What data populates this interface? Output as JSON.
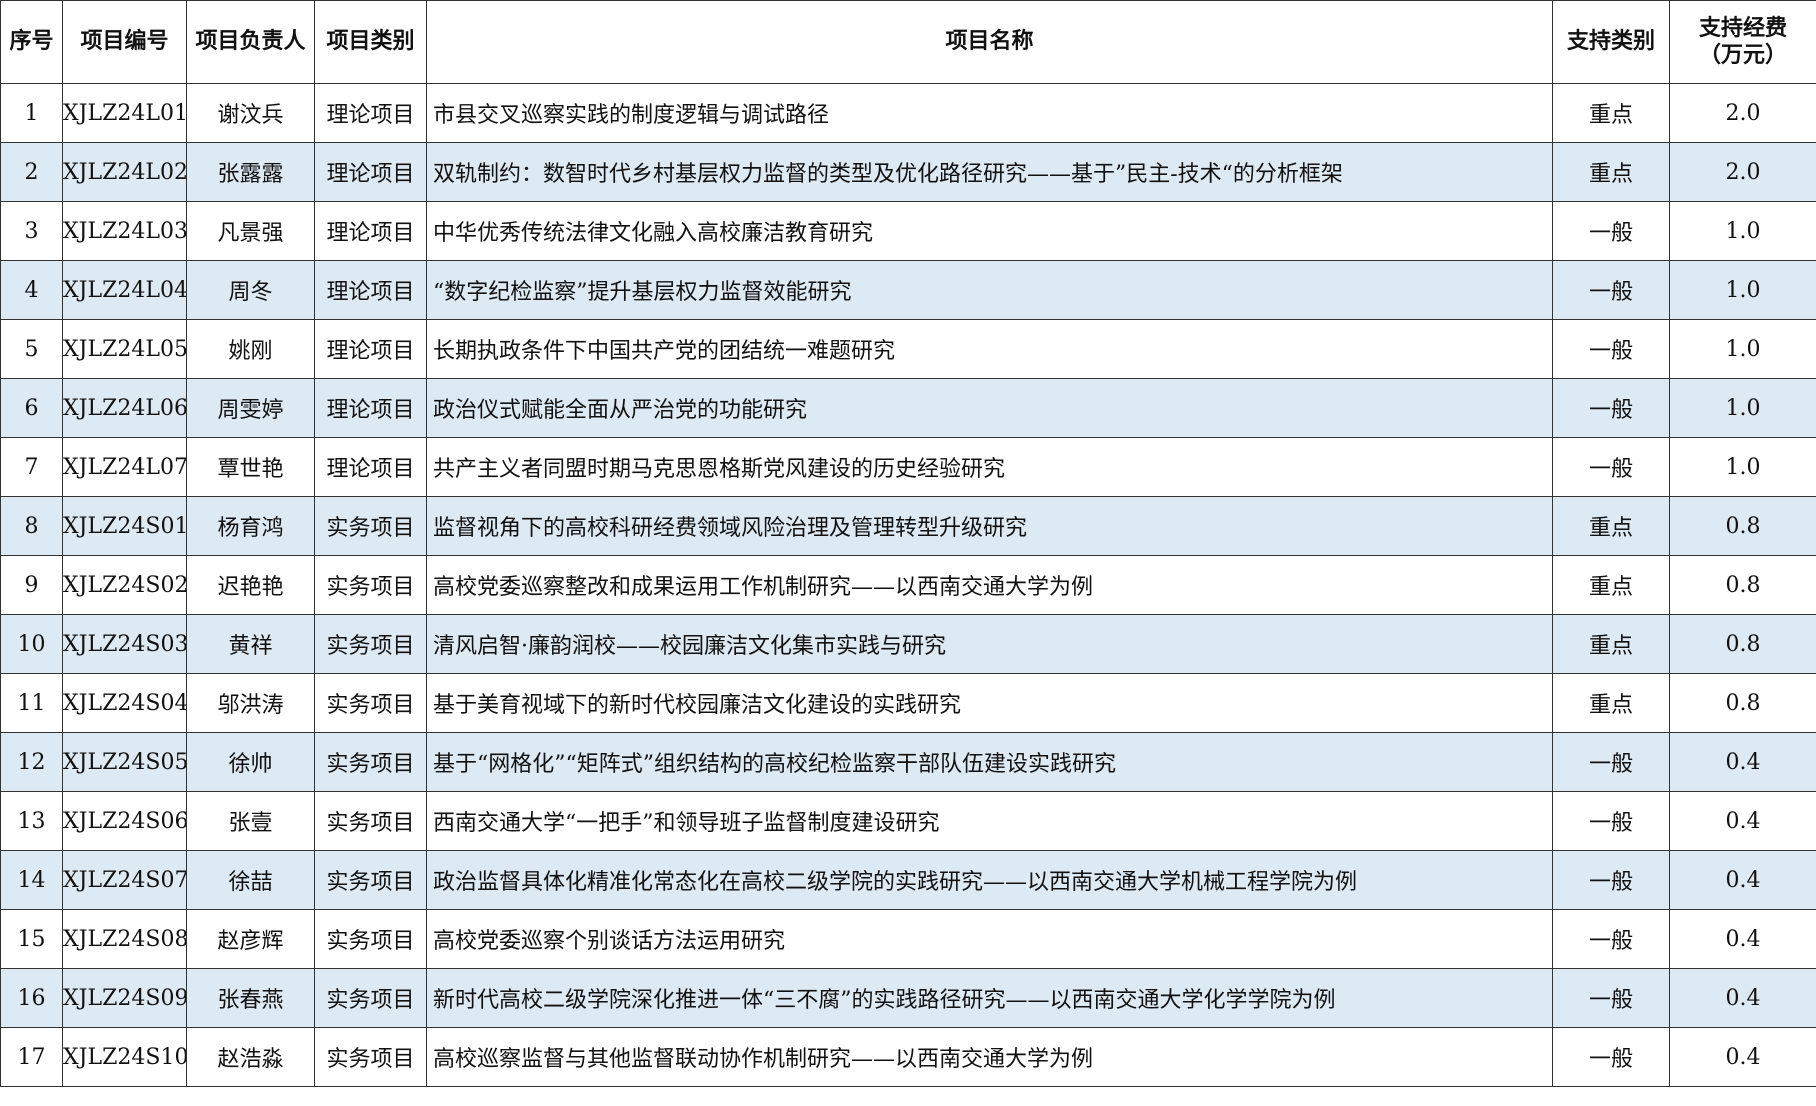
{
  "headers": {
    "seq": "序号",
    "code": "项目编号",
    "leader": "项目负责人",
    "category": "项目类别",
    "name": "项目名称",
    "support_type": "支持类别",
    "funding_line1": "支持经费",
    "funding_line2": "（万元）"
  },
  "rows": [
    {
      "seq": "1",
      "code": "XJLZ24L01",
      "leader": "谢汶兵",
      "category": "理论项目",
      "name": "市县交叉巡察实践的制度逻辑与调试路径",
      "support": "重点",
      "funding": "2.0"
    },
    {
      "seq": "2",
      "code": "XJLZ24L02",
      "leader": "张露露",
      "category": "理论项目",
      "name": "双轨制约：数智时代乡村基层权力监督的类型及优化路径研究——基于”民主-技术“的分析框架",
      "support": "重点",
      "funding": "2.0"
    },
    {
      "seq": "3",
      "code": "XJLZ24L03",
      "leader": "凡景强",
      "category": "理论项目",
      "name": "中华优秀传统法律文化融入高校廉洁教育研究",
      "support": "一般",
      "funding": "1.0"
    },
    {
      "seq": "4",
      "code": "XJLZ24L04",
      "leader": "周冬",
      "category": "理论项目",
      "name": "“数字纪检监察”提升基层权力监督效能研究",
      "support": "一般",
      "funding": "1.0"
    },
    {
      "seq": "5",
      "code": "XJLZ24L05",
      "leader": "姚刚",
      "category": "理论项目",
      "name": "长期执政条件下中国共产党的团结统一难题研究",
      "support": "一般",
      "funding": "1.0"
    },
    {
      "seq": "6",
      "code": "XJLZ24L06",
      "leader": "周雯婷",
      "category": "理论项目",
      "name": "政治仪式赋能全面从严治党的功能研究",
      "support": "一般",
      "funding": "1.0"
    },
    {
      "seq": "7",
      "code": "XJLZ24L07",
      "leader": "覃世艳",
      "category": "理论项目",
      "name": "共产主义者同盟时期马克思恩格斯党风建设的历史经验研究",
      "support": "一般",
      "funding": "1.0"
    },
    {
      "seq": "8",
      "code": "XJLZ24S01",
      "leader": "杨育鸿",
      "category": "实务项目",
      "name": "监督视角下的高校科研经费领域风险治理及管理转型升级研究",
      "support": "重点",
      "funding": "0.8"
    },
    {
      "seq": "9",
      "code": "XJLZ24S02",
      "leader": "迟艳艳",
      "category": "实务项目",
      "name": "高校党委巡察整改和成果运用工作机制研究——以西南交通大学为例",
      "support": "重点",
      "funding": "0.8"
    },
    {
      "seq": "10",
      "code": "XJLZ24S03",
      "leader": "黄祥",
      "category": "实务项目",
      "name": "清风启智·廉韵润校——校园廉洁文化集市实践与研究",
      "support": "重点",
      "funding": "0.8"
    },
    {
      "seq": "11",
      "code": "XJLZ24S04",
      "leader": "邬洪涛",
      "category": "实务项目",
      "name": "基于美育视域下的新时代校园廉洁文化建设的实践研究",
      "support": "重点",
      "funding": "0.8"
    },
    {
      "seq": "12",
      "code": "XJLZ24S05",
      "leader": "徐帅",
      "category": "实务项目",
      "name": "基于“网格化”“矩阵式”组织结构的高校纪检监察干部队伍建设实践研究",
      "support": "一般",
      "funding": "0.4"
    },
    {
      "seq": "13",
      "code": "XJLZ24S06",
      "leader": "张壹",
      "category": "实务项目",
      "name": "西南交通大学“一把手”和领导班子监督制度建设研究",
      "support": "一般",
      "funding": "0.4"
    },
    {
      "seq": "14",
      "code": "XJLZ24S07",
      "leader": "徐喆",
      "category": "实务项目",
      "name": "政治监督具体化精准化常态化在高校二级学院的实践研究——以西南交通大学机械工程学院为例",
      "support": "一般",
      "funding": "0.4"
    },
    {
      "seq": "15",
      "code": "XJLZ24S08",
      "leader": "赵彦辉",
      "category": "实务项目",
      "name": "高校党委巡察个别谈话方法运用研究",
      "support": "一般",
      "funding": "0.4"
    },
    {
      "seq": "16",
      "code": "XJLZ24S09",
      "leader": "张春燕",
      "category": "实务项目",
      "name": "新时代高校二级学院深化推进一体“三不腐”的实践路径研究——以西南交通大学化学学院为例",
      "support": "一般",
      "funding": "0.4"
    },
    {
      "seq": "17",
      "code": "XJLZ24S10",
      "leader": "赵浩淼",
      "category": "实务项目",
      "name": "高校巡察监督与其他监督联动协作机制研究——以西南交通大学为例",
      "support": "一般",
      "funding": "0.4"
    }
  ],
  "colors": {
    "stripe": "#dde9f3",
    "border": "#333333"
  }
}
